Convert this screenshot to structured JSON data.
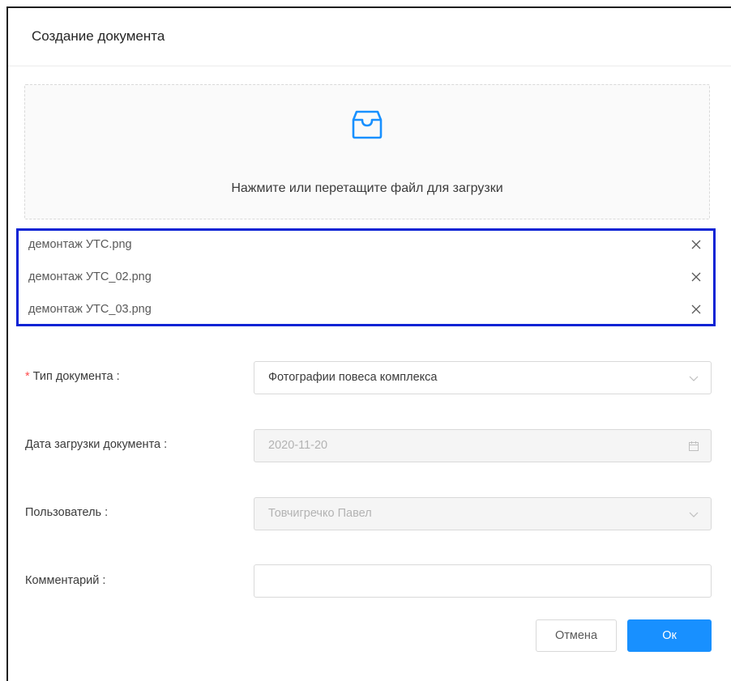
{
  "dialog": {
    "title": "Создание документа"
  },
  "upload": {
    "icon": "inbox-icon",
    "hint": "Нажмите или перетащите файл для загрузки",
    "files": [
      {
        "name": "демонтаж УТС.png"
      },
      {
        "name": "демонтаж УТС_02.png"
      },
      {
        "name": "демонтаж УТС_03.png"
      }
    ],
    "remove_symbol": "X"
  },
  "form": {
    "doc_type": {
      "required_mark": "*",
      "label": "Тип документа",
      "value": "Фотографии повеса комплекса"
    },
    "upload_date": {
      "label": "Дата загрузки документа",
      "value": "2020-11-20"
    },
    "user": {
      "label": "Пользователь",
      "value": "Товчигречко Павел"
    },
    "comment": {
      "label": "Комментарий",
      "value": ""
    }
  },
  "footer": {
    "cancel_label": "Отмена",
    "ok_label": "Ок"
  },
  "colors": {
    "primary": "#1890ff",
    "required": "#ff4d4f",
    "highlight_border": "#0a23d4"
  }
}
